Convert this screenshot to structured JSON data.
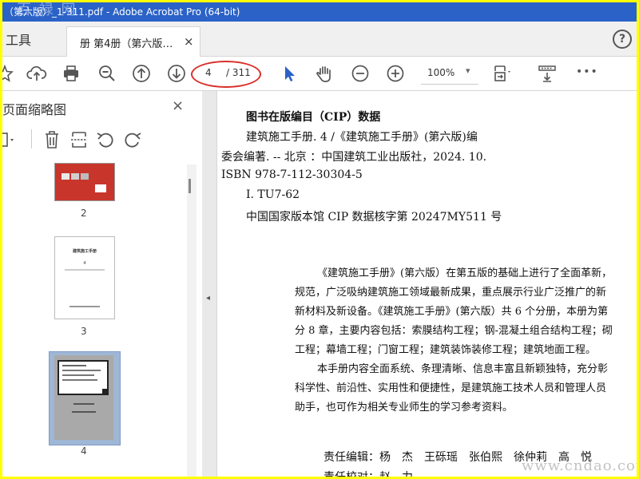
{
  "window": {
    "title": "（第六版）_1-311.pdf - Adobe Acrobat Pro (64-bit)",
    "watermark_top": "百 禄 网"
  },
  "tabs": {
    "tools": "工具",
    "doc": "册 第4册（第六版…",
    "close": "×",
    "help": "?"
  },
  "toolbar": {
    "icons": [
      "star-icon",
      "cloud-upload-icon",
      "print-icon",
      "zoom-out-search-icon",
      "page-up-icon",
      "page-down-icon",
      "select-cursor-icon",
      "hand-icon",
      "zoom-out-icon",
      "zoom-in-icon",
      "page-fit-icon",
      "scroll-mode-icon",
      "more-icon"
    ],
    "page_current": "4",
    "page_total": "/ 311",
    "zoom": "100%",
    "zoom_arrow": "▾",
    "more": "•••",
    "highlight_color": "#d9302a"
  },
  "sidebar": {
    "title": "页面缩略图",
    "close": "×",
    "thumbs": [
      {
        "page": "2"
      },
      {
        "page": "3",
        "title": "建筑施工手册",
        "sub": "4"
      },
      {
        "page": "4"
      }
    ]
  },
  "collapse": "◂",
  "doc": {
    "cip_title": "图书在版编目（CIP）数据",
    "cip_lines": [
      "建筑施工手册. 4 /《建筑施工手册》(第六版)编",
      "委会编著. -- 北京 ：中国建筑工业出版社，2024. 10.",
      "ISBN 978-7-112-30304-5",
      "Ⅰ. TU7-62",
      "中国国家版本馆 CIP 数据核字第 20247MY511 号"
    ],
    "body": [
      "《建筑施工手册》(第六版）在第五版的基础上进行了全面革新，",
      "规范，广泛吸纳建筑施工领域最新成果，重点展示行业广泛推广的新",
      "新材料及新设备。《建筑施工手册》(第六版）共 6 个分册，本册为第",
      "分 8 章，主要内容包括：索膜结构工程；钢-混凝土组合结构工程；砌",
      "工程；幕墙工程；门窗工程；建筑装饰装修工程；建筑地面工程。",
      "本手册内容全面系统、条理清晰、信息丰富且新颖独特，充分彰",
      "科学性、前沿性、实用性和便捷性，是建筑施工技术人员和管理人员",
      "助手，也可作为相关专业师生的学习参考资料。"
    ],
    "editors": "责任编辑：杨　杰　王砾瑶　张伯熙　徐仲莉　高　悦",
    "proof": "责任校对：赵　力"
  },
  "watermark_bottom": "www.cndao.com"
}
